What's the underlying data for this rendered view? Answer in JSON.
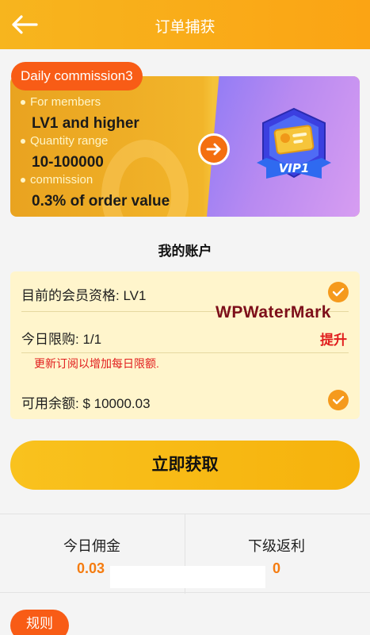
{
  "header": {
    "title": "订单捕获",
    "back_icon": "arrow-left-icon"
  },
  "banner": {
    "badge": "Daily commission3",
    "rows": [
      {
        "label": "For members",
        "value": "LV1 and higher"
      },
      {
        "label": "Quantity range",
        "value": "10-100000"
      },
      {
        "label": "commission",
        "value": "0.3% of order value"
      }
    ],
    "arrow_icon": "arrow-right-circle-icon",
    "vip_badge_text": "VIP1",
    "colors": {
      "left": "#f0ac25",
      "right": "#b88af1",
      "badge": "#f85c16"
    }
  },
  "account": {
    "title": "我的账户",
    "membership": "目前的会员资格: LV1",
    "daily_limit": "今日限购: 1/1",
    "upgrade_label": "提升",
    "note": "更新订阅以增加每日限额.",
    "balance": "可用余额: $ 10000.03",
    "watermark": "WPWaterMark"
  },
  "cta": {
    "label": "立即获取"
  },
  "stats": {
    "today_commission_label": "今日佣金",
    "today_commission_value": "0.03",
    "sub_rebate_label": "下级返利",
    "sub_rebate_value": "0"
  },
  "rules": {
    "label": "规则"
  }
}
